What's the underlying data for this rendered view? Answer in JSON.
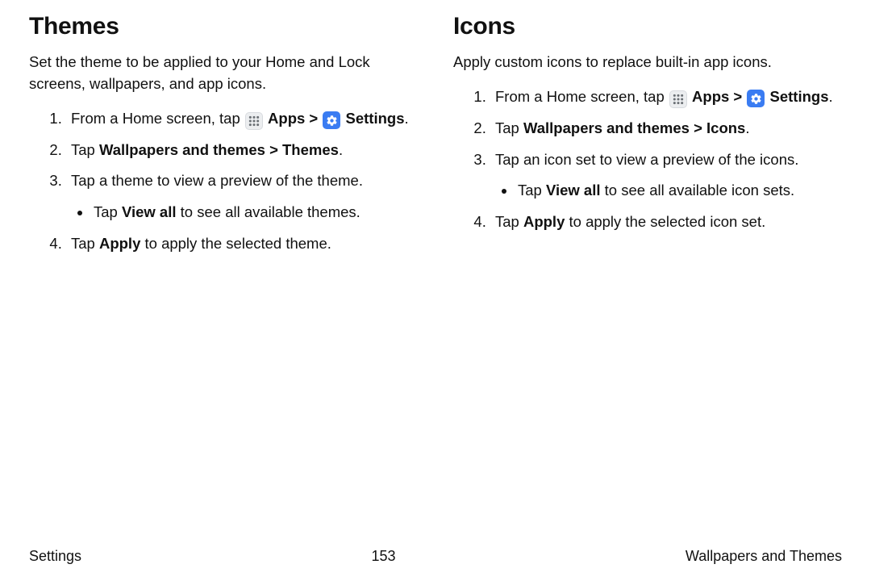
{
  "left": {
    "heading": "Themes",
    "intro": "Set the theme to be applied to your Home and Lock screens, wallpapers, and app icons.",
    "step1_pre": "From a Home screen, tap ",
    "step1_apps": "Apps",
    "step1_sep": " > ",
    "step1_settings": "Settings",
    "step1_end": ".",
    "step2_pre": "Tap ",
    "step2_bold": "Wallpapers and themes > Themes",
    "step2_end": ".",
    "step3": "Tap a theme to view a preview of the theme.",
    "step3_sub_pre": "Tap ",
    "step3_sub_bold": "View all",
    "step3_sub_post": " to see all available themes.",
    "step4_pre": "Tap ",
    "step4_bold": "Apply",
    "step4_post": " to apply the selected theme."
  },
  "right": {
    "heading": "Icons",
    "intro": "Apply custom icons to replace built-in app icons.",
    "step1_pre": "From a Home screen, tap ",
    "step1_apps": "Apps",
    "step1_sep": " > ",
    "step1_settings": "Settings",
    "step1_end": ".",
    "step2_pre": "Tap ",
    "step2_bold": "Wallpapers and themes > Icons",
    "step2_end": ".",
    "step3": "Tap an icon set to view a preview of the icons.",
    "step3_sub_pre": "Tap ",
    "step3_sub_bold": "View all",
    "step3_sub_post": " to see all available icon sets.",
    "step4_pre": "Tap ",
    "step4_bold": "Apply",
    "step4_post": " to apply the selected icon set."
  },
  "footer": {
    "left": "Settings",
    "center": "153",
    "right": "Wallpapers and Themes"
  }
}
